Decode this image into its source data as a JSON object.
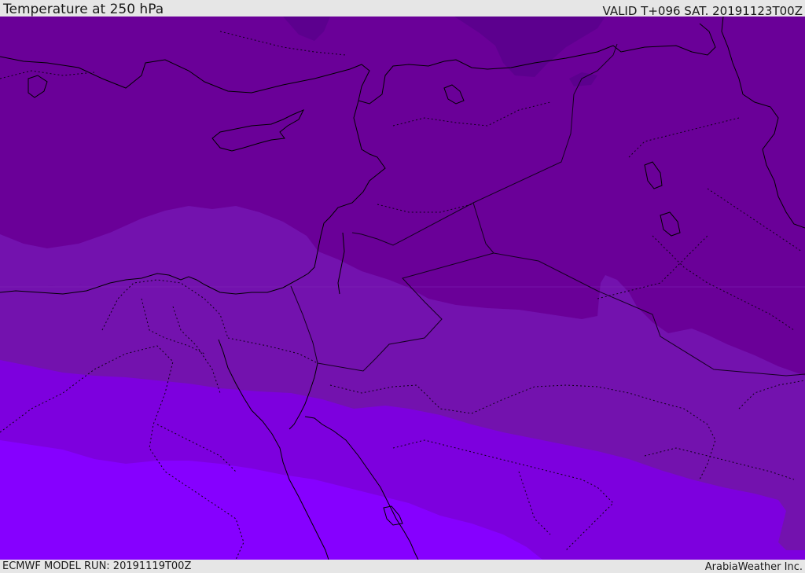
{
  "header": {
    "title": "Temperature at 250 hPa",
    "valid_time": "VALID T+096 SAT. 20191123T00Z"
  },
  "footer": {
    "model_run": "ECMWF MODEL RUN: 20191119T00Z",
    "credit": "ArabiaWeather Inc."
  },
  "map": {
    "region": "Eastern Mediterranean / Middle East",
    "colors": {
      "band_coldest": "#5e0090",
      "band_cold": "#6a0098",
      "band_mid": "#7510b0",
      "band_warm": "#7f00dc",
      "band_warmest": "#8500ff",
      "coastline": "#000000",
      "border": "#1a0030"
    }
  }
}
